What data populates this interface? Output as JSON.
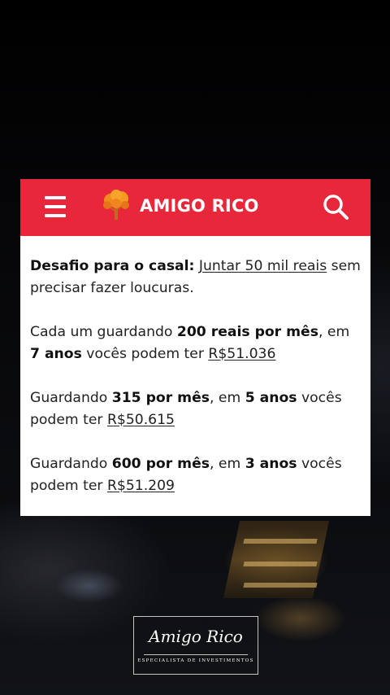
{
  "header": {
    "brand_name": "AMIGO RICO",
    "menu_icon": "hamburger-menu-icon",
    "search_icon": "search-icon",
    "logo_icon": "money-tree-icon",
    "background_color": "#e8283a"
  },
  "post": {
    "intro": {
      "lead_bold": "Desafio para o casal:",
      "goal_link": "Juntar 50 mil reais",
      "rest": "sem precisar fazer loucuras."
    },
    "scenarios": [
      {
        "prefix": "Cada um guardando ",
        "amount": "200 reais por mês",
        "mid": ", em ",
        "period": "7 anos",
        "suffix": " vocês podem ter ",
        "result": "R$51.036"
      },
      {
        "prefix": "Guardando ",
        "amount": "315 por mês",
        "mid": ", em ",
        "period": "5 anos",
        "suffix": " vocês podem ter ",
        "result": "R$50.615"
      },
      {
        "prefix": "Guardando ",
        "amount": "600 por mês",
        "mid": ", em ",
        "period": "3 anos",
        "suffix": " vocês podem ter ",
        "result": "R$51.209"
      }
    ]
  },
  "watermark": {
    "signature": "Amigo Rico",
    "subtitle": "ESPECIALISTA DE INVESTIMENTOS"
  }
}
